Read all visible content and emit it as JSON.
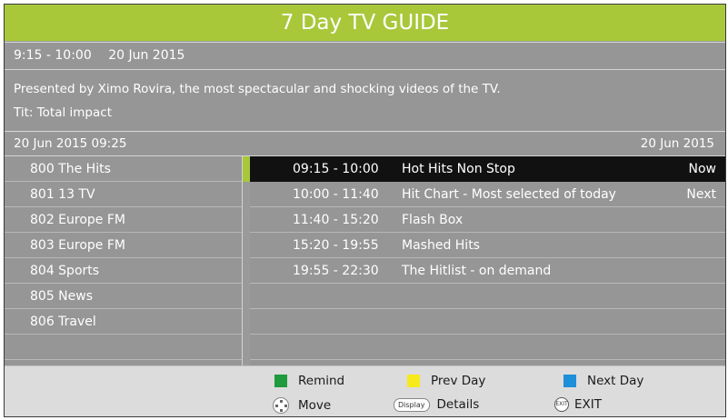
{
  "title": "7 Day TV GUIDE",
  "timebar": {
    "time_range": "9:15 - 10:00",
    "date": "20 Jun 2015"
  },
  "description": {
    "line1": "Presented by Ximo Rovira, the most spectacular and shocking videos of the TV.",
    "line2": "Tit: Total impact"
  },
  "datebar": {
    "left": "20 Jun 2015 09:25",
    "right": "20 Jun 2015"
  },
  "channels": [
    "800 The Hits",
    "801 13 TV",
    "802 Europe FM",
    "803 Europe FM",
    "804 Sports",
    "805 News",
    "806 Travel"
  ],
  "programs": [
    {
      "time": "09:15 - 10:00",
      "title": "Hot Hits Non Stop",
      "tag": "Now"
    },
    {
      "time": "10:00 - 11:40",
      "title": "Hit Chart - Most selected of today",
      "tag": "Next"
    },
    {
      "time": "11:40 - 15:20",
      "title": "Flash Box",
      "tag": ""
    },
    {
      "time": "15:20 - 19:55",
      "title": "Mashed Hits",
      "tag": ""
    },
    {
      "time": "19:55 - 22:30",
      "title": "The Hitlist - on demand",
      "tag": ""
    }
  ],
  "footer": {
    "remind": "Remind",
    "prev_day": "Prev Day",
    "next_day": "Next Day",
    "move": "Move",
    "display_icon": "Display",
    "details": "Details",
    "exit_icon": "EXIT",
    "exit": "EXIT"
  },
  "colors": {
    "accent": "#a8c83a",
    "remind": "#1f9a3c",
    "prev_day": "#f7ea1c",
    "next_day": "#1e8fd8"
  },
  "icons": {
    "move": "dpad-icon",
    "details": "display-button-icon",
    "exit": "exit-button-icon"
  }
}
